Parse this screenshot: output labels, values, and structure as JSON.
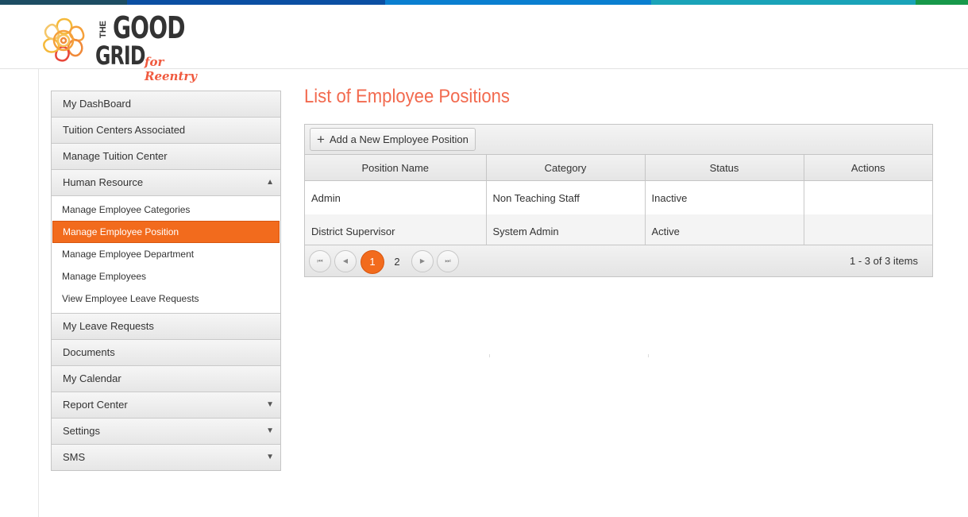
{
  "colors": {
    "strip": [
      "#1d4d63",
      "#0b4fa3",
      "#0a7fd0",
      "#1aa3b8",
      "#17984a"
    ],
    "accent": "#f26b1d",
    "title": "#f26a4f"
  },
  "logo": {
    "the": "THE",
    "good": "GOOD",
    "grid": "GRID",
    "tagline": "for Reentry"
  },
  "sidebar": {
    "items": [
      {
        "label": "My DashBoard"
      },
      {
        "label": "Tuition Centers Associated"
      },
      {
        "label": "Manage Tuition Center"
      },
      {
        "label": "Human Resource",
        "arrow": "▲"
      },
      {
        "label": "My Leave Requests"
      },
      {
        "label": "Documents"
      },
      {
        "label": "My Calendar"
      },
      {
        "label": "Report Center",
        "arrow": "▼"
      },
      {
        "label": "Settings",
        "arrow": "▼"
      },
      {
        "label": "SMS",
        "arrow": "▼"
      }
    ],
    "submenu": [
      {
        "label": "Manage Employee Categories"
      },
      {
        "label": "Manage Employee Position",
        "active": true
      },
      {
        "label": "Manage Employee Department"
      },
      {
        "label": "Manage Employees"
      },
      {
        "label": "View Employee Leave Requests"
      }
    ]
  },
  "main": {
    "title": "List of Employee Positions",
    "add_button": "Add a New Employee Position",
    "add_icon": "+",
    "columns": [
      "Position Name",
      "Category",
      "Status",
      "Actions"
    ],
    "rows": [
      [
        "Admin",
        "Non Teaching Staff",
        "Inactive",
        ""
      ],
      [
        "District Supervisor",
        "System Admin",
        "Active",
        ""
      ]
    ],
    "pager": {
      "first": "⏮",
      "prev": "◀",
      "pages": [
        "1",
        "2"
      ],
      "next": "▶",
      "last": "⏭",
      "info": "1 - 3 of 3 items"
    }
  }
}
